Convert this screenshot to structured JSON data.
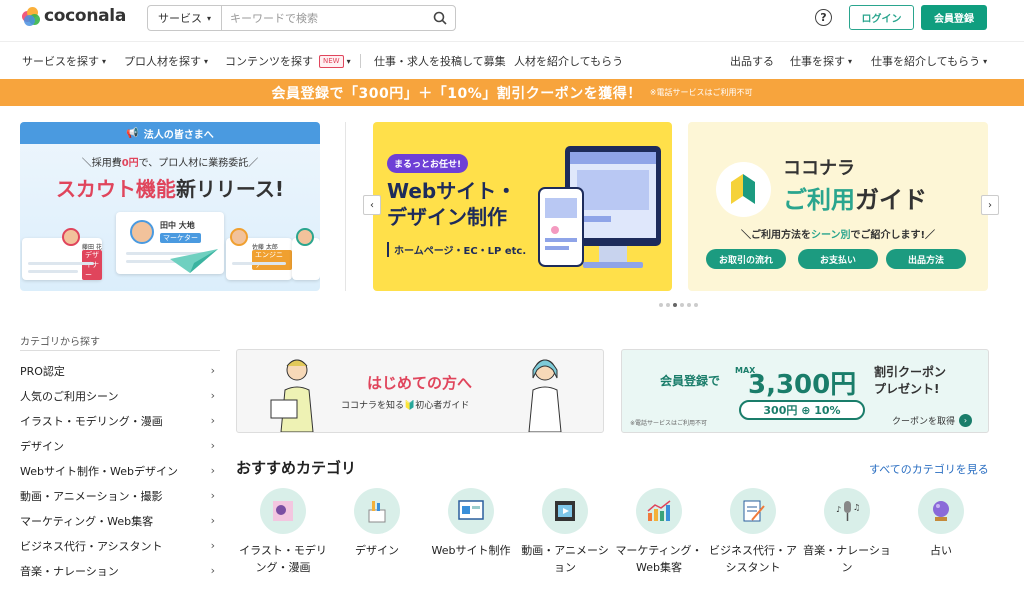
{
  "header": {
    "logo_text": "coconala",
    "search_category": "サービス",
    "search_placeholder": "キーワードで検索",
    "help_label": "?",
    "login_label": "ログイン",
    "register_label": "会員登録"
  },
  "nav": {
    "left": [
      {
        "label": "サービスを探す"
      },
      {
        "label": "プロ人材を探す"
      },
      {
        "label": "コンテンツを探す",
        "badge": "NEW"
      },
      {
        "label": "仕事・求人を投稿して募集"
      },
      {
        "label": "人材を紹介してもらう"
      }
    ],
    "right": [
      {
        "label": "出品する"
      },
      {
        "label": "仕事を探す"
      },
      {
        "label": "仕事を紹介してもらう"
      }
    ]
  },
  "promo": {
    "main": "会員登録で「300円」＋「10%」割引クーポンを獲得！",
    "note": "※電話サービスはご利用不可"
  },
  "banners": {
    "b1": {
      "top": "法人の皆さまへ",
      "sub_pre": "採用費",
      "sub_em": "0円",
      "sub_post": "で、プロ人材に業務委託",
      "title_em": "スカウト機能",
      "title_rest": "新リリース!",
      "center_name": "田中 大地",
      "center_tag": "マーケター",
      "left_name": "藤田 花子",
      "left_tag": "デザイナー",
      "right_name": "佐藤 太郎",
      "right_tag": "エンジニア"
    },
    "b2": {
      "pill": "まるっとお任せ!",
      "title_line1": "Webサイト・",
      "title_line2": "デザイン制作",
      "sub": "ホームページ・EC・LP etc."
    },
    "b3": {
      "title1": "ココナラ",
      "title2_em": "ご利用",
      "title2_rest": "ガイド",
      "sub_pre": "ご利用方法を",
      "sub_em": "シーン別",
      "sub_post": "でご紹介します!",
      "buttons": [
        "お取引の流れ",
        "お支払い",
        "出品方法"
      ]
    }
  },
  "carousel": {
    "prev": "‹",
    "next": "›",
    "dots": 6,
    "active_dot": 3
  },
  "sidebar": {
    "heading": "カテゴリから探す",
    "items": [
      {
        "label": "PRO認定"
      },
      {
        "label": "人気のご利用シーン"
      },
      {
        "label": "イラスト・モデリング・漫画"
      },
      {
        "label": "デザイン"
      },
      {
        "label": "Webサイト制作・Webデザイン"
      },
      {
        "label": "動画・アニメーション・撮影"
      },
      {
        "label": "マーケティング・Web集客"
      },
      {
        "label": "ビジネス代行・アシスタント"
      },
      {
        "label": "音楽・ナレーション"
      }
    ]
  },
  "cards": {
    "beginner": {
      "title": "はじめての方へ",
      "sub": "ココナラを知る🔰初心者ガイド"
    },
    "coupon": {
      "main": "会員登録で",
      "max": "MAX",
      "amount": "3,300円",
      "pill": "300円 ⊕ 10%",
      "right_line1": "割引クーポン",
      "right_line2": "プレゼント!",
      "note": "※電話サービスはご利用不可",
      "link": "クーポンを取得"
    }
  },
  "recommended": {
    "title": "おすすめカテゴリ",
    "all_link": "すべてのカテゴリを見る",
    "items": [
      {
        "label": "イラスト・モデリング・漫画",
        "icon": "illustration-icon"
      },
      {
        "label": "デザイン",
        "icon": "design-icon"
      },
      {
        "label": "Webサイト制作",
        "icon": "website-icon"
      },
      {
        "label": "動画・アニメーション",
        "icon": "video-icon"
      },
      {
        "label": "マーケティング・Web集客",
        "icon": "marketing-icon"
      },
      {
        "label": "ビジネス代行・アシスタント",
        "icon": "business-icon"
      },
      {
        "label": "音楽・ナレーション",
        "icon": "music-icon"
      },
      {
        "label": "占い",
        "icon": "fortune-icon"
      }
    ]
  },
  "colors": {
    "brand": "#0f9e7f",
    "promo": "#f7a43d",
    "accent_red": "#e0455c",
    "link_blue": "#2b6fc2"
  }
}
